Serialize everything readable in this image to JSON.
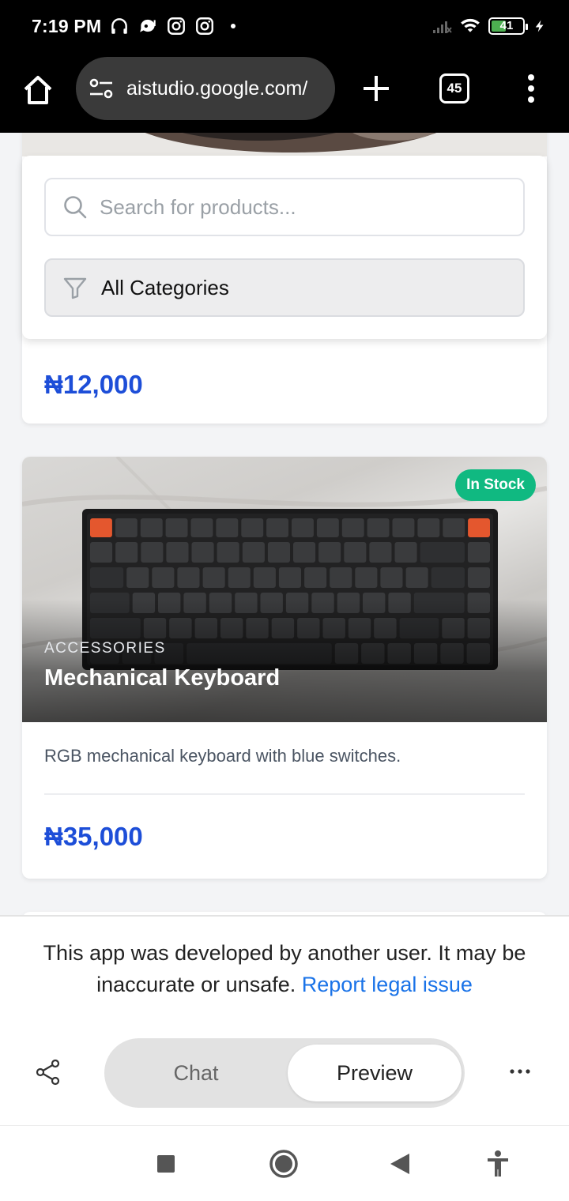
{
  "status_bar": {
    "time": "7:19 PM",
    "battery_level": "41"
  },
  "browser": {
    "url": "aistudio.google.com/",
    "tab_count": "45"
  },
  "filters": {
    "search_placeholder": "Search for products...",
    "category_label": "All Categories"
  },
  "products": [
    {
      "price": "₦12,000"
    },
    {
      "badge": "In Stock",
      "category": "ACCESSORIES",
      "name": "Mechanical Keyboard",
      "description": "RGB mechanical keyboard with blue switches.",
      "price": "₦35,000"
    }
  ],
  "footer": {
    "notice": "This app was developed by another user. It may be inaccurate or unsafe.",
    "report_link": "Report legal issue",
    "tab_chat": "Chat",
    "tab_preview": "Preview"
  },
  "colors": {
    "price": "#1d4ed8",
    "badge": "#10b981",
    "link": "#1a73e8"
  }
}
